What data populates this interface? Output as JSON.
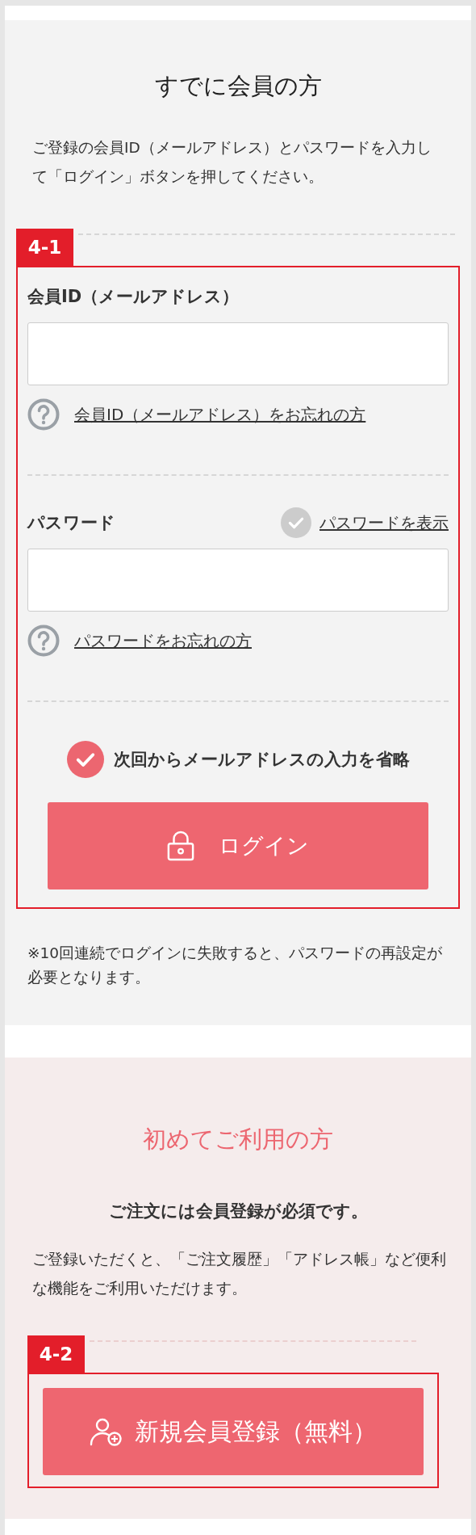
{
  "member_login": {
    "title": "すでに会員の方",
    "description": "ご登録の会員ID（メールアドレス）とパスワードを入力して「ログイン」ボタンを押してください。",
    "badge": "4-1",
    "fields": [
      {
        "label": "会員ID（メールアドレス）",
        "help_link": "会員ID（メールアドレス）をお忘れの方"
      },
      {
        "label": "パスワード",
        "show_password": {
          "label": "パスワードを表示",
          "checked": false
        },
        "help_link": "パスワードをお忘れの方"
      }
    ],
    "remember": {
      "label": "次回からメールアドレスの入力を省略",
      "checked": true
    },
    "login_button": "ログイン",
    "note": "※10回連続でログインに失敗すると、パスワードの再設定が必要となります。"
  },
  "new_customer": {
    "title": "初めてご利用の方",
    "lead": "ご注文には会員登録が必須です。",
    "description": "ご登録いただくと、「ご注文履歴」「アドレス帳」など便利な機能をご利用いただけます。",
    "badge": "4-2",
    "register_button": "新規会員登録（無料）"
  }
}
